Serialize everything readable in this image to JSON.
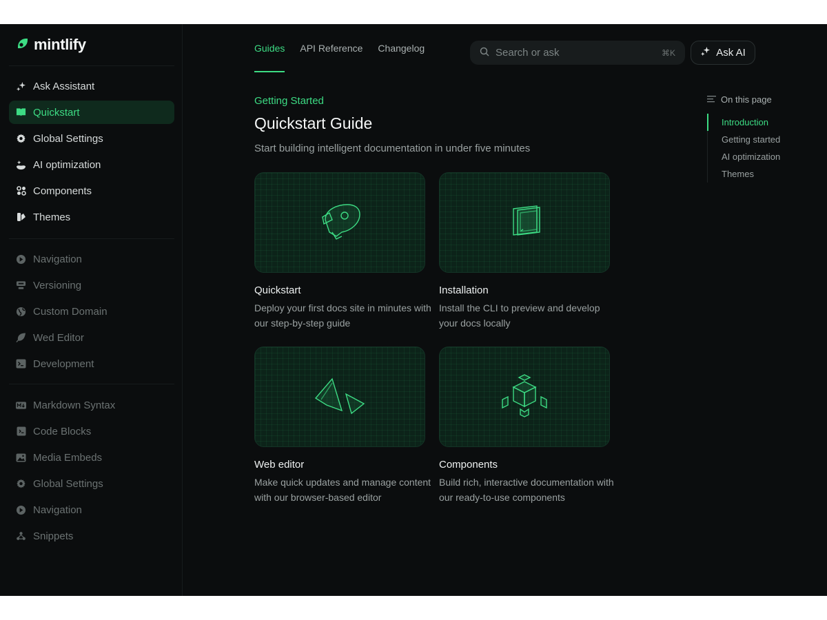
{
  "brand": {
    "name": "mintlify",
    "accent": "#3ddc84"
  },
  "sidebar": {
    "primary": [
      {
        "label": "Ask Assistant",
        "icon": "sparkle-icon"
      },
      {
        "label": "Quickstart",
        "icon": "book-icon",
        "active": true
      },
      {
        "label": "Global Settings",
        "icon": "gear-icon"
      },
      {
        "label": "AI optimization",
        "icon": "ai-sparkles-icon"
      },
      {
        "label": "Components",
        "icon": "components-icon"
      },
      {
        "label": "Themes",
        "icon": "palette-icon"
      }
    ],
    "secondary": [
      {
        "label": "Navigation",
        "icon": "navigation-icon"
      },
      {
        "label": "Versioning",
        "icon": "versioning-icon"
      },
      {
        "label": "Custom Domain",
        "icon": "globe-icon"
      },
      {
        "label": "Wed Editor",
        "icon": "leaf-icon"
      },
      {
        "label": "Development",
        "icon": "terminal-icon"
      }
    ],
    "tertiary": [
      {
        "label": "Markdown Syntax",
        "icon": "markdown-icon"
      },
      {
        "label": "Code Blocks",
        "icon": "code-icon"
      },
      {
        "label": "Media Embeds",
        "icon": "image-icon"
      },
      {
        "label": "Global Settings",
        "icon": "gear-icon"
      },
      {
        "label": "Navigation",
        "icon": "navigation-icon"
      },
      {
        "label": "Snippets",
        "icon": "snippets-icon"
      }
    ]
  },
  "topnav": {
    "tabs": [
      {
        "label": "Guides",
        "active": true
      },
      {
        "label": "API Reference"
      },
      {
        "label": "Changelog"
      }
    ],
    "search": {
      "placeholder": "Search or ask",
      "shortcut": "⌘K"
    },
    "ask_ai": "Ask AI"
  },
  "page": {
    "eyebrow": "Getting Started",
    "title": "Quickstart Guide",
    "subtitle": "Start building intelligent documentation in under five minutes",
    "cards": [
      {
        "title": "Quickstart",
        "description": "Deploy your first docs site in minutes with our step-by-step guide",
        "icon": "rocket-icon"
      },
      {
        "title": "Installation",
        "description": "Install the CLI to preview and develop your docs locally",
        "icon": "terminal-window-icon"
      },
      {
        "title": "Web editor",
        "description": "Make quick updates and manage content with our browser-based editor",
        "icon": "cursor-shapes-icon"
      },
      {
        "title": "Components",
        "description": "Build rich, interactive documentation with our ready-to-use components",
        "icon": "blocks-icon"
      }
    ]
  },
  "toc": {
    "heading": "On this page",
    "items": [
      {
        "label": "Introduction",
        "active": true
      },
      {
        "label": "Getting started"
      },
      {
        "label": "AI optimization"
      },
      {
        "label": "Themes"
      }
    ]
  }
}
